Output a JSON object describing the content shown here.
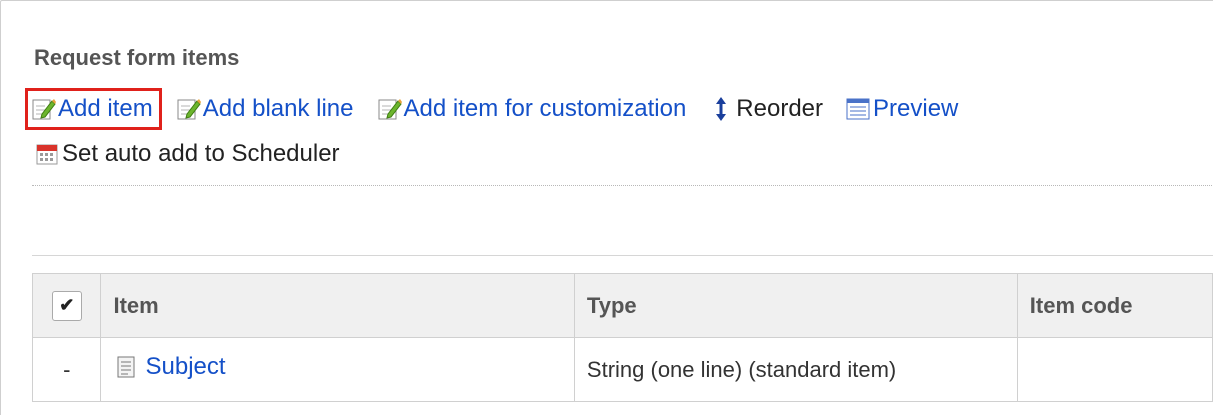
{
  "section": {
    "title": "Request form items"
  },
  "toolbar": {
    "add_item": "Add item",
    "add_blank_line": "Add blank line",
    "add_item_customization": "Add item for customization",
    "reorder": "Reorder",
    "preview": "Preview",
    "auto_add_scheduler": "Set auto add to Scheduler"
  },
  "table": {
    "headers": {
      "check": "✔",
      "item": "Item",
      "type": "Type",
      "item_code": "Item code"
    },
    "rows": [
      {
        "mark": "-",
        "item": "Subject",
        "type": "String (one line) (standard item)",
        "item_code": ""
      }
    ]
  },
  "colors": {
    "link": "#1450c8",
    "highlight": "#e0211b",
    "header_bg": "#f0f0f0"
  },
  "icons": [
    "edit-icon",
    "reorder-icon",
    "preview-icon",
    "calendar-icon",
    "document-icon"
  ]
}
